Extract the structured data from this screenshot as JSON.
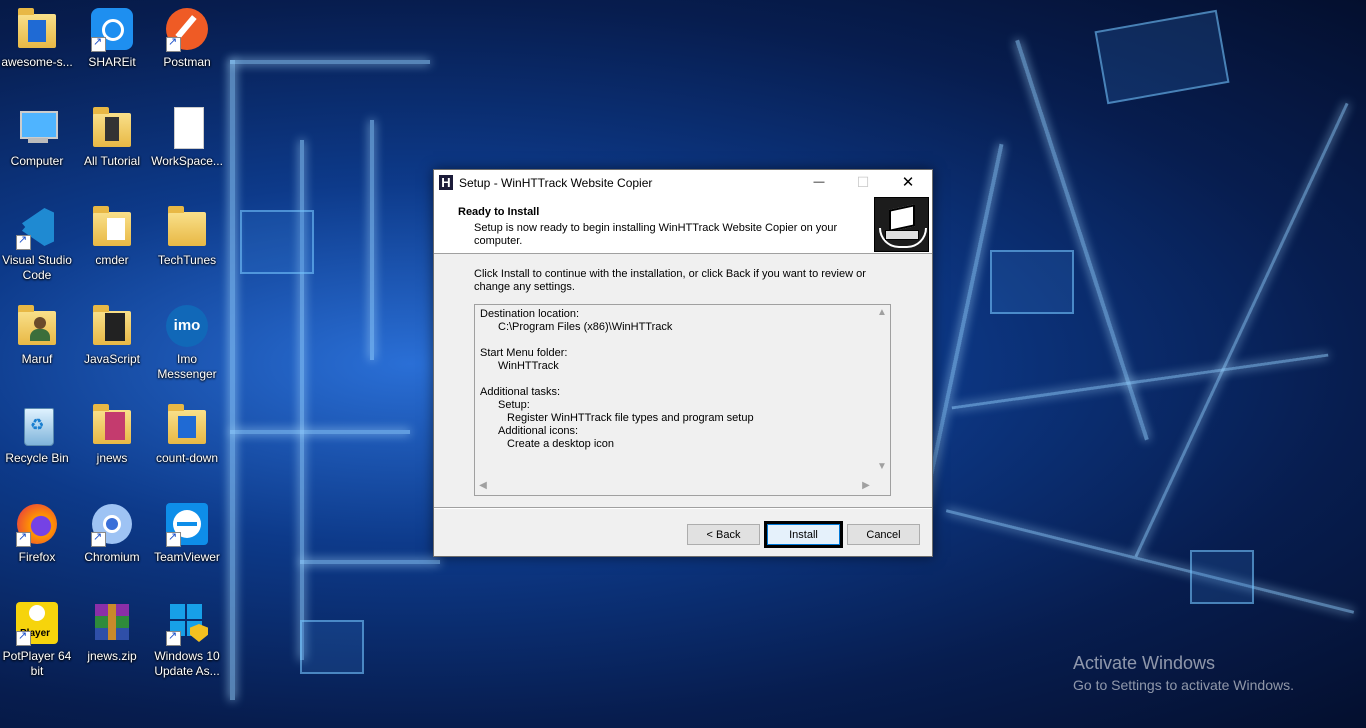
{
  "desktop": {
    "icons": [
      {
        "label": "awesome-s..."
      },
      {
        "label": "SHAREit"
      },
      {
        "label": "Postman"
      },
      {
        "label": "Computer"
      },
      {
        "label": "All Tutorial"
      },
      {
        "label": "WorkSpace..."
      },
      {
        "label": "Visual Studio Code"
      },
      {
        "label": "cmder"
      },
      {
        "label": "TechTunes"
      },
      {
        "label": "Maruf"
      },
      {
        "label": "JavaScript"
      },
      {
        "label": "Imo Messenger"
      },
      {
        "label": "Recycle Bin"
      },
      {
        "label": "jnews"
      },
      {
        "label": "count-down"
      },
      {
        "label": "Firefox"
      },
      {
        "label": "Chromium"
      },
      {
        "label": "TeamViewer"
      },
      {
        "label": "PotPlayer 64 bit"
      },
      {
        "label": "jnews.zip"
      },
      {
        "label": "Windows 10 Update As..."
      }
    ],
    "imo_glyph": "imo",
    "potplayer_glyph": "Player"
  },
  "dialog": {
    "title": "Setup - WinHTTrack Website Copier",
    "logo_letter": "H",
    "minimize_glyph": "—",
    "maximize_glyph": "☐",
    "close_glyph": "✕",
    "header_title": "Ready to Install",
    "header_desc": "Setup is now ready to begin installing WinHTTrack Website Copier on your computer.",
    "intro": "Click Install to continue with the installation, or click Back if you want to review or change any settings.",
    "memo": {
      "dest_label": "Destination location:",
      "dest_value": "C:\\Program Files (x86)\\WinHTTrack",
      "startmenu_label": "Start Menu folder:",
      "startmenu_value": "WinHTTrack",
      "tasks_label": "Additional tasks:",
      "setup_label": "Setup:",
      "setup_task": "Register WinHTTrack file types and program setup",
      "icons_label": "Additional icons:",
      "icons_task": "Create a desktop icon"
    },
    "buttons": {
      "back": "< Back",
      "install": "Install",
      "cancel": "Cancel"
    }
  },
  "watermark": {
    "title": "Activate Windows",
    "subtitle": "Go to Settings to activate Windows."
  }
}
